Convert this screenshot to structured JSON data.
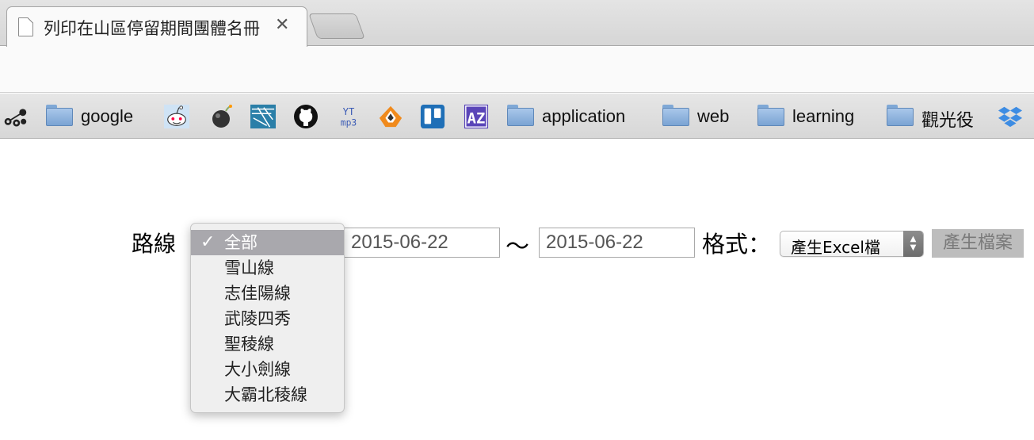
{
  "tab": {
    "title": "列印在山區停留期間團體名冊",
    "close": "✕"
  },
  "bookmarks": {
    "items": [
      {
        "type": "icon",
        "icon": "molecule-icon"
      },
      {
        "type": "folder",
        "label": "google"
      },
      {
        "type": "icon",
        "icon": "reddit-icon"
      },
      {
        "type": "icon",
        "icon": "bomb-icon"
      },
      {
        "type": "icon",
        "icon": "network-icon"
      },
      {
        "type": "icon",
        "icon": "github-icon"
      },
      {
        "type": "icon",
        "icon": "yt-mp3-icon",
        "text_top": "YT",
        "text_bottom": "mp3"
      },
      {
        "type": "icon",
        "icon": "orange-app-icon"
      },
      {
        "type": "icon",
        "icon": "trello-icon"
      },
      {
        "type": "icon",
        "icon": "az-icon",
        "text": "AZ"
      },
      {
        "type": "folder",
        "label": "application"
      },
      {
        "type": "folder",
        "label": "web"
      },
      {
        "type": "folder",
        "label": "learning"
      },
      {
        "type": "folder",
        "label": "觀光役"
      },
      {
        "type": "icon",
        "icon": "dropbox-icon"
      }
    ]
  },
  "form": {
    "route_label": "路線",
    "route_options": [
      "全部",
      "雪山線",
      "志佳陽線",
      "武陵四秀",
      "聖稜線",
      "大小劍線",
      "大霸北稜線"
    ],
    "route_selected": "全部",
    "check_mark": "✓",
    "start_date": "2015-06-22",
    "separator": "〜",
    "end_date": "2015-06-22",
    "format_label": "格式：",
    "format_selected": "產生Excel檔",
    "generate_button": "產生檔案"
  },
  "colors": {
    "folder": "#7aa3d3",
    "dropdown_selected": "#a9a8ad",
    "button_disabled": "#bdbdbd",
    "dropbox": "#3d8ce3",
    "trello": "#1f6fb7",
    "az": "#5a45b8"
  }
}
